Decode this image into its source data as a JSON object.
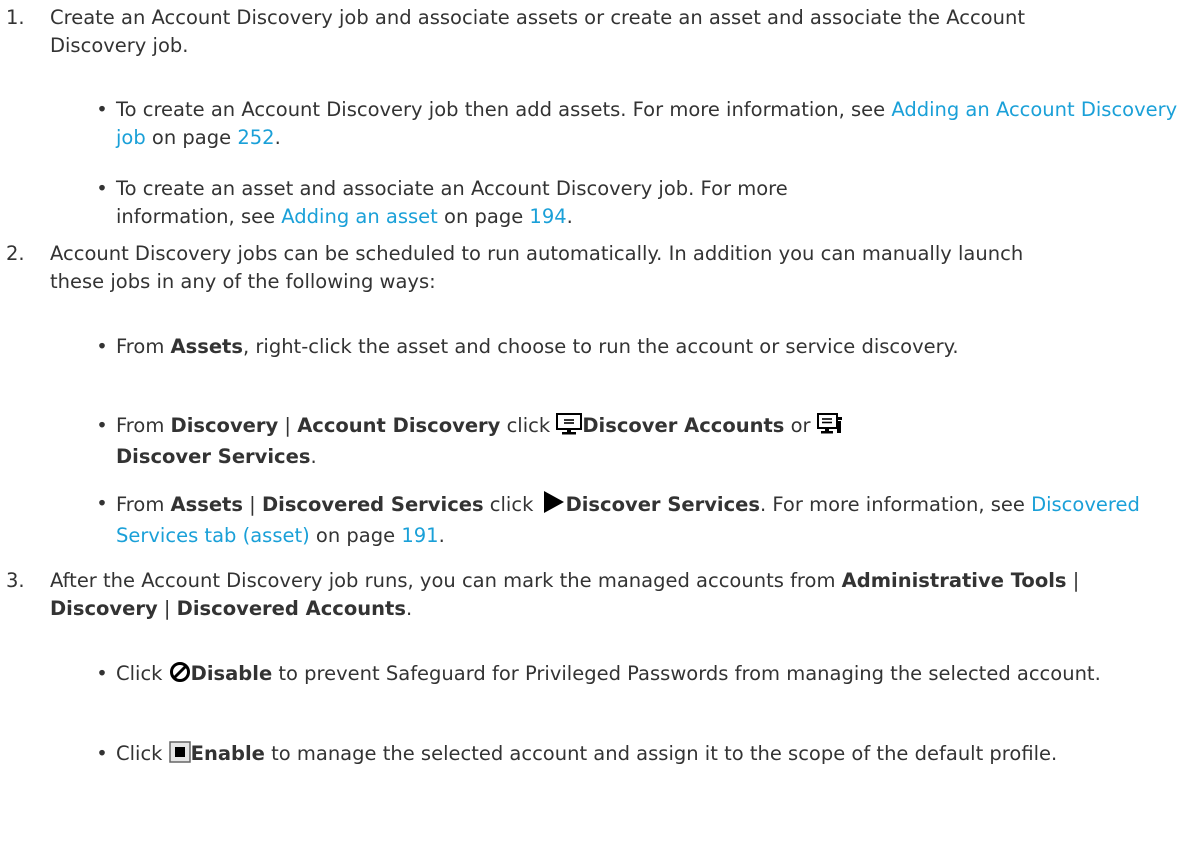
{
  "steps": [
    {
      "number": "1.",
      "text": "Create an Account Discovery job and associate assets or create an asset and associate the Account Discovery job.",
      "bullets": [
        {
          "prefix": "To create an Account Discovery job then add assets. For more information, see ",
          "link": "Adding an Account Discovery job",
          "mid": " on page ",
          "page": "252",
          "suffix": "."
        },
        {
          "prefix": "To create an asset and associate an Account Discovery job. For more information, see ",
          "link": "Adding an asset",
          "mid": " on page ",
          "page": "194",
          "suffix": "."
        }
      ]
    },
    {
      "number": "2.",
      "text": "Account Discovery jobs can be scheduled to run automatically. In addition you can manually launch these jobs in any of the following ways:",
      "bullets": [
        {
          "from": "From ",
          "assets": "Assets",
          "rest": ", right-click the asset and choose to run the account or service discovery."
        },
        {
          "from": "From ",
          "discovery": "Discovery",
          "sep": " | ",
          "account_discovery": "Account Discovery",
          "click": " click ",
          "discover_accounts": "Discover Accounts",
          "or": " or ",
          "discover_services": "Discover Services",
          "end": "."
        },
        {
          "from": "From ",
          "assets": "Assets",
          "sep": " | ",
          "discovered_services": "Discovered Services",
          "click": " click ",
          "discover_services": "Discover Services",
          "more": ". For more information, see ",
          "link": "Discovered Services tab (asset)",
          "mid": " on page ",
          "page": "191",
          "end": "."
        }
      ]
    },
    {
      "number": "3.",
      "prefix": "After the Account Discovery job runs, you can mark the managed accounts from ",
      "admin_tools": "Administrative Tools",
      "sep": " | ",
      "discovery": "Discovery",
      "discovered_accounts": "Discovered Accounts",
      "end": ".",
      "bullets": [
        {
          "click": "Click ",
          "label": "Disable",
          "rest": " to prevent Safeguard for Privileged Passwords from managing the selected account."
        },
        {
          "click": "Click ",
          "label": "Enable",
          "rest": " to manage the selected account and assign it to the scope of the default profile."
        }
      ]
    }
  ],
  "bullet_glyph": "•",
  "icons": {
    "discover_accounts": "monitor-icon",
    "discover_services": "monitor-settings-icon",
    "run": "play-triangle-icon",
    "disable": "prohibited-circle-icon",
    "enable": "checkbox-square-icon"
  },
  "colors": {
    "link": "#1aa0d8",
    "text": "#333333"
  }
}
